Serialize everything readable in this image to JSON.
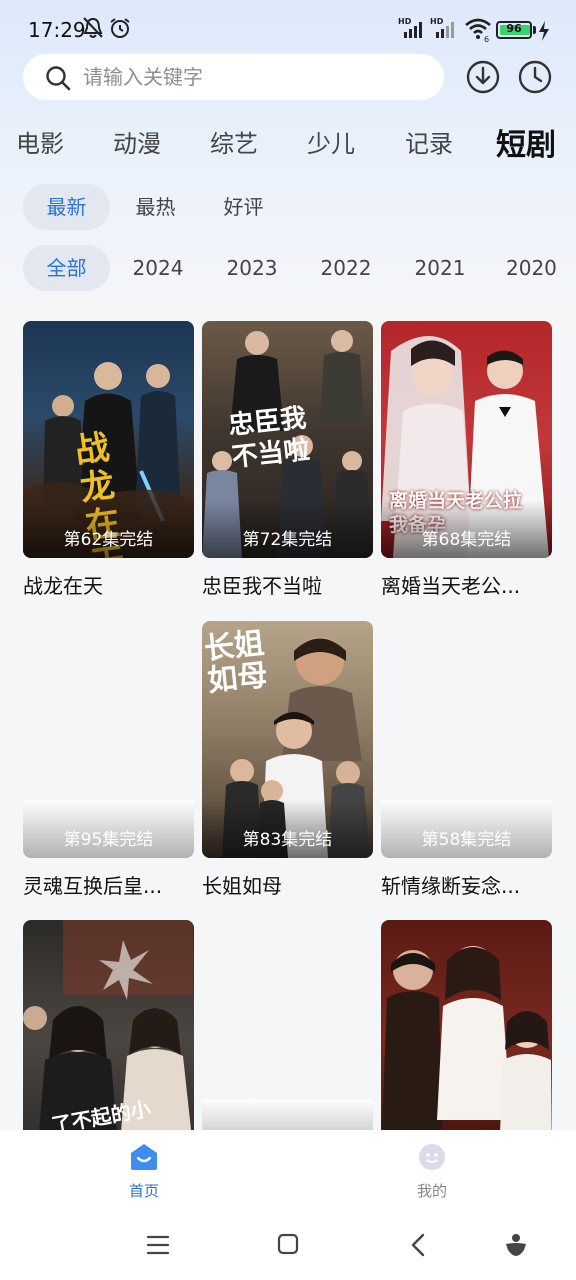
{
  "status_bar": {
    "time": "17:29",
    "battery": "96"
  },
  "search": {
    "placeholder": "请输入关键字"
  },
  "categories": [
    {
      "label": "电影",
      "active": false
    },
    {
      "label": "动漫",
      "active": false
    },
    {
      "label": "综艺",
      "active": false
    },
    {
      "label": "少儿",
      "active": false
    },
    {
      "label": "记录",
      "active": false
    },
    {
      "label": "短剧",
      "active": true
    }
  ],
  "sort_filters": [
    {
      "label": "最新",
      "active": true
    },
    {
      "label": "最热",
      "active": false
    },
    {
      "label": "好评",
      "active": false
    }
  ],
  "year_filters": [
    {
      "label": "全部",
      "active": true
    },
    {
      "label": "2024",
      "active": false
    },
    {
      "label": "2023",
      "active": false
    },
    {
      "label": "2022",
      "active": false
    },
    {
      "label": "2021",
      "active": false
    },
    {
      "label": "2020",
      "active": false
    }
  ],
  "cards": [
    {
      "title": "战龙在天",
      "badge": "第62集完结",
      "poster_text": "战龙在天"
    },
    {
      "title": "忠臣我不当啦",
      "badge": "第72集完结",
      "poster_text": "忠臣我不当啦"
    },
    {
      "title": "离婚当天老公...",
      "badge": "第68集完结",
      "poster_text": "离婚当天老公拉我备孕"
    },
    {
      "title": "灵魂互换后皇...",
      "badge": "第95集完结",
      "poster_text": ""
    },
    {
      "title": "长姐如母",
      "badge": "第83集完结",
      "poster_text": "长姐如母"
    },
    {
      "title": "斩情缘断妄念...",
      "badge": "第58集完结",
      "poster_text": ""
    },
    {
      "title": "",
      "badge": "",
      "poster_text": "了不起的小姐"
    },
    {
      "title": "",
      "badge": "",
      "poster_text": ""
    },
    {
      "title": "",
      "badge": "",
      "poster_text": ""
    }
  ],
  "bottom_nav": [
    {
      "label": "首页",
      "icon": "home-icon",
      "active": true
    },
    {
      "label": "我的",
      "icon": "profile-icon",
      "active": false
    }
  ],
  "colors": {
    "accent": "#2a73d9",
    "active_chip_bg": "#e3e8f0"
  }
}
